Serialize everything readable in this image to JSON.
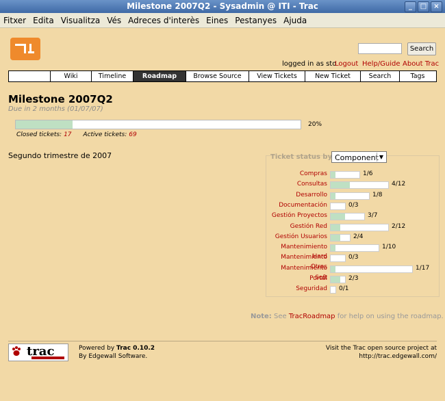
{
  "window": {
    "title": "Milestone 2007Q2 - Sysadmin @ ITI - Trac"
  },
  "menu": [
    "Fitxer",
    "Edita",
    "Visualitza",
    "Vés",
    "Adreces d'interès",
    "Eines",
    "Pestanyes",
    "Ajuda"
  ],
  "header": {
    "search_button": "Search",
    "logged_in": "logged in as sto",
    "links": [
      "Logout",
      "Help/Guide",
      "About Trac"
    ]
  },
  "nav": [
    "Wiki",
    "Timeline",
    "Roadmap",
    "Browse Source",
    "View Tickets",
    "New Ticket",
    "Search",
    "Tags"
  ],
  "milestone": {
    "title": "Milestone 2007Q2",
    "due": "Due in 2 months (01/07/07)",
    "progress_percent": 20,
    "progress_label": "20%",
    "closed_label": "Closed tickets:",
    "closed": "17",
    "active_label": "Active tickets:",
    "active": "69",
    "description": "Segundo trimestre de 2007"
  },
  "status": {
    "label": "Ticket status by",
    "selected": "Component",
    "rows": [
      {
        "name": "Compras",
        "text": "1/6",
        "closed": 1,
        "total": 6
      },
      {
        "name": "Consultas",
        "text": "4/12",
        "closed": 4,
        "total": 12
      },
      {
        "name": "Desarrollo",
        "text": "1/8",
        "closed": 1,
        "total": 8
      },
      {
        "name": "Documentación",
        "text": "0/3",
        "closed": 0,
        "total": 3
      },
      {
        "name": "Gestión Proyectos",
        "text": "3/7",
        "closed": 3,
        "total": 7
      },
      {
        "name": "Gestión Red",
        "text": "2/12",
        "closed": 2,
        "total": 12
      },
      {
        "name": "Gestión Usuarios",
        "text": "2/4",
        "closed": 2,
        "total": 4
      },
      {
        "name": "Mantenimiento Hard",
        "text": "1/10",
        "closed": 1,
        "total": 10
      },
      {
        "name": "Mantenimiento Otros",
        "text": "0/3",
        "closed": 0,
        "total": 3
      },
      {
        "name": "Mantenimiento Soft",
        "text": "1/17",
        "closed": 1,
        "total": 17
      },
      {
        "name": "Portal",
        "text": "2/3",
        "closed": 2,
        "total": 3
      },
      {
        "name": "Seguridad",
        "text": "0/1",
        "closed": 0,
        "total": 1
      }
    ]
  },
  "note": {
    "prefix": "Note:",
    "pre": "See",
    "link": "TracRoadmap",
    "post": "for help on using the roadmap."
  },
  "footer": {
    "badge_word": "trac",
    "powered_prefix": "Powered by",
    "powered_name": "Trac 0.10.2",
    "by": "By Edgewall Software.",
    "visit": "Visit the Trac open source project at",
    "url": "http://trac.edgewall.com/"
  },
  "colors": {
    "accent": "#b00000",
    "progress": "#bfe0c3",
    "page_bg": "#f2d9a6"
  }
}
